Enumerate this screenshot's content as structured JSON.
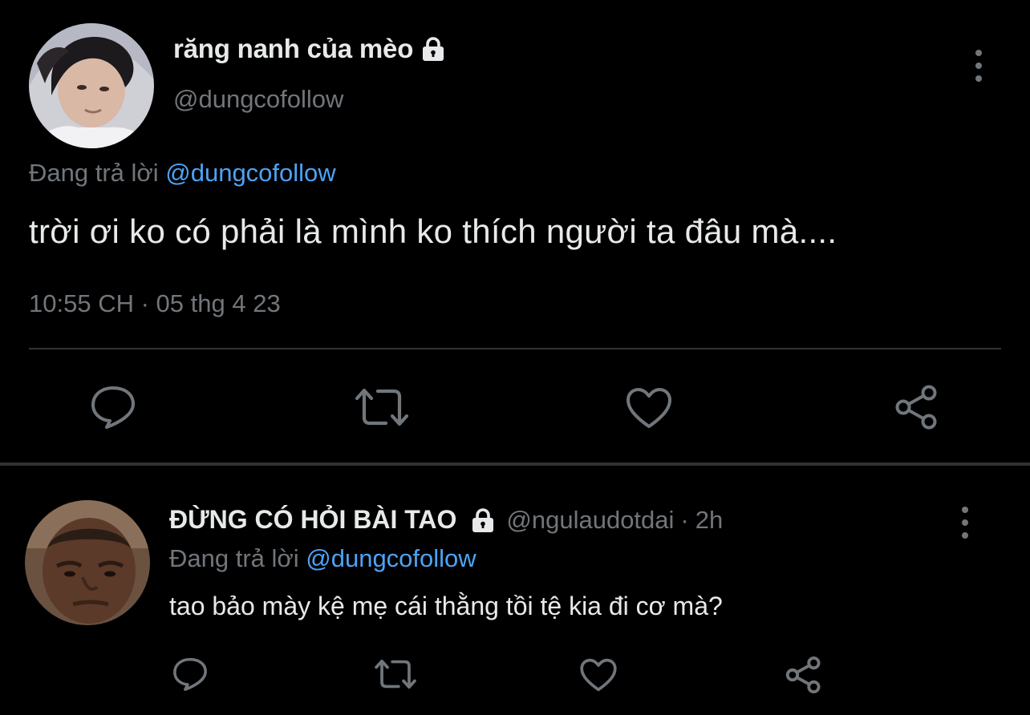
{
  "main_tweet": {
    "display_name": "răng nanh của mèo",
    "handle": "@dungcofollow",
    "replying_prefix": "Đang trả lời",
    "replying_to": "@dungcofollow",
    "text": "trời ơi ko có phải là mình ko thích người ta đâu mà....",
    "time": "10:55 CH",
    "separator": "·",
    "date": "05 thg 4 23",
    "actions": [
      "reply-icon",
      "retweet-icon",
      "like-icon",
      "share-icon"
    ]
  },
  "reply_tweet": {
    "display_name": "ĐỪNG CÓ HỎI BÀI TAO",
    "handle": "@ngulaudotdai",
    "separator": "·",
    "age": "2h",
    "replying_prefix": "Đang trả lời",
    "replying_to": "@dungcofollow",
    "text": "tao bảo mày kệ mẹ cái thằng tồi tệ kia đi cơ mà?",
    "actions": [
      "reply-icon",
      "retweet-icon",
      "like-icon",
      "share-icon"
    ]
  },
  "colors": {
    "background": "#000000",
    "primary_text": "#e7e9ea",
    "secondary_text": "#71767b",
    "link": "#4ca3f5",
    "divider": "#2f3336"
  }
}
